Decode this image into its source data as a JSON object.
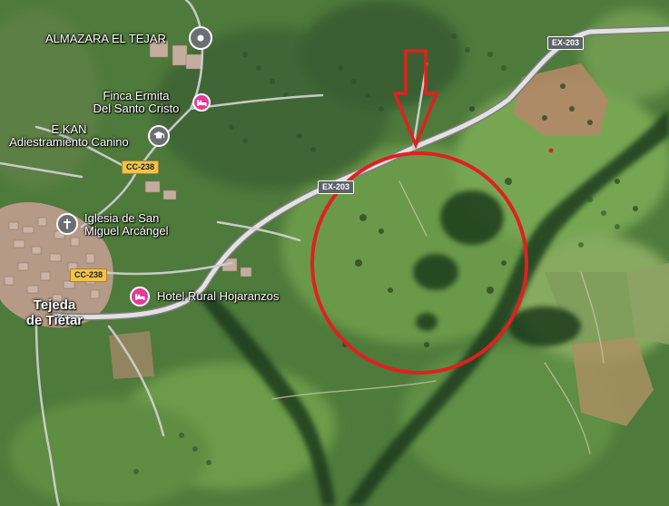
{
  "places": {
    "almazara": "ALMAZARA EL TEJAR",
    "finca_line1": "Finca Ermita",
    "finca_line2": "Del Santo Cristo",
    "ekan_line1": "E.KAN",
    "ekan_line2": "Adiestramiento Canino",
    "iglesia_line1": "Iglesia de San",
    "iglesia_line2": "Miguel Arcángel",
    "hotel": "Hotel Rural Hojaranzos",
    "town_line1": "Tejeda",
    "town_line2": "de Tiétar"
  },
  "roads": {
    "cc238_a": "CC-238",
    "cc238_b": "CC-238",
    "ex203_a": "EX-203",
    "ex203_b": "EX-203"
  },
  "icons": {
    "almazara": "place-pin-icon",
    "finca": "lodging-icon",
    "ekan": "education-icon",
    "iglesia": "church-icon",
    "hotel": "lodging-icon",
    "arrow": "red-down-arrow",
    "circle": "red-circle-annotation"
  },
  "colors": {
    "annotation": "#e02020",
    "lodging": "#e5399b",
    "poi_gray": "#6b6f73",
    "road": "#d8d8d8",
    "shield_yellow": "#f2c24a"
  }
}
